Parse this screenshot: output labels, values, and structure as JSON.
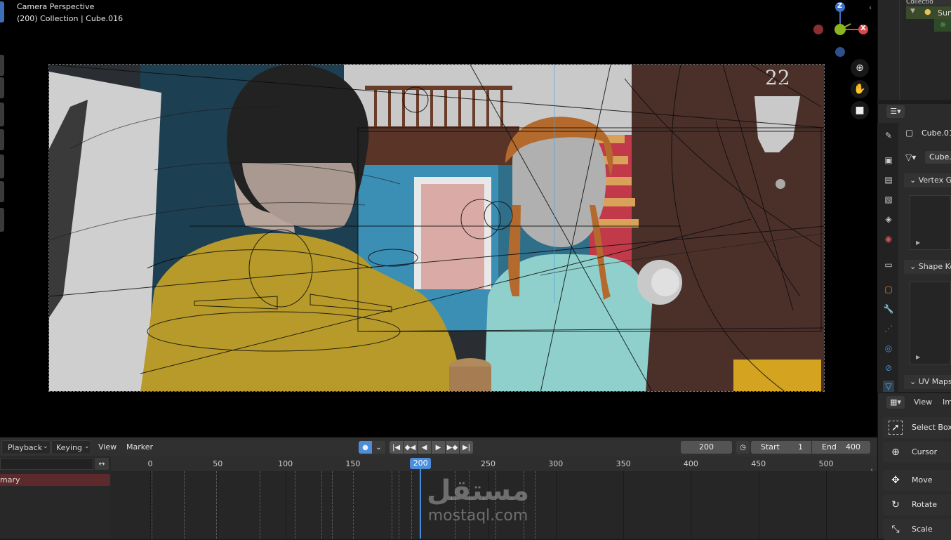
{
  "viewport": {
    "mode": "Camera Perspective",
    "info": "(200) Collection | Cube.016",
    "door_number": "22",
    "gizmo": {
      "z": "Z",
      "x": "X"
    },
    "nav_icons": [
      "zoom-icon",
      "hand-icon",
      "camera-icon"
    ]
  },
  "outliner": {
    "row1": "Collectio",
    "row2": "Sun"
  },
  "properties": {
    "object_name": "Cube.01",
    "data_name": "Cube.",
    "panels": [
      "Vertex Gr",
      "Shape Ke",
      "UV Maps"
    ]
  },
  "toolbar": {
    "menu_view": "View",
    "menu_image": "Im",
    "tools": [
      "Select Box",
      "Cursor",
      "Move",
      "Rotate",
      "Scale"
    ]
  },
  "timeline": {
    "menus": {
      "playback": "Playback",
      "keying": "Keying",
      "view": "View",
      "marker": "Marker"
    },
    "current_frame": "200",
    "start_label": "Start",
    "start_value": "1",
    "end_label": "End",
    "end_value": "400",
    "ruler_ticks": [
      "0",
      "50",
      "100",
      "150",
      "200",
      "250",
      "300",
      "350",
      "400",
      "450",
      "500"
    ],
    "playhead": "200",
    "summary": "mary"
  },
  "watermark": {
    "arabic": "مستقل",
    "latin": "mostaql.com"
  },
  "colors": {
    "accent_blue": "#4b8ddb",
    "axis_red": "#d84a4a",
    "axis_green": "#8ab620",
    "axis_blue": "#3f72c4",
    "summary_red": "#5c2a2a"
  }
}
